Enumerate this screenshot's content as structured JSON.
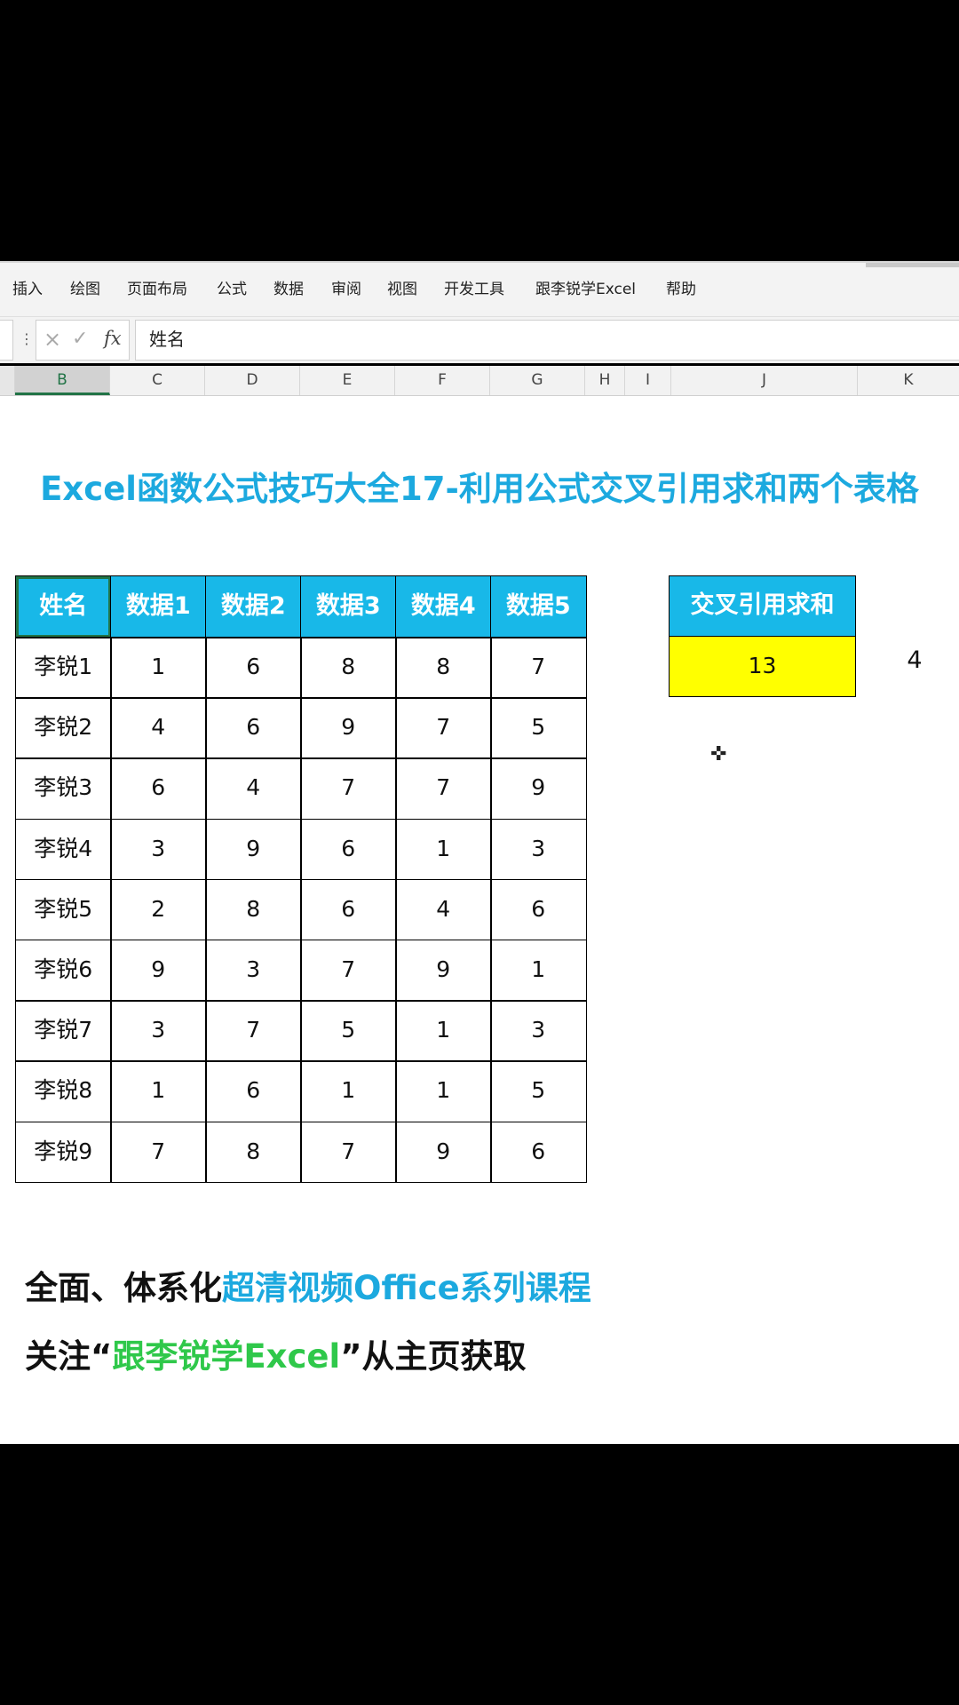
{
  "menu": [
    "插入",
    "绘图",
    "页面布局",
    "公式",
    "数据",
    "审阅",
    "视图",
    "开发工具",
    "跟李锐学Excel",
    "帮助"
  ],
  "formula_bar": {
    "fx_label": "fx",
    "cancel_icon": "×",
    "confirm_icon": "✓",
    "content": "姓名"
  },
  "columns": [
    "B",
    "C",
    "D",
    "E",
    "F",
    "G",
    "H",
    "I",
    "J",
    "K"
  ],
  "title": "Excel函数公式技巧大全17-利用公式交叉引用求和两个表格",
  "table": {
    "headers": [
      "姓名",
      "数据1",
      "数据2",
      "数据3",
      "数据4",
      "数据5"
    ],
    "rows": [
      [
        "李锐1",
        "1",
        "6",
        "8",
        "8",
        "7"
      ],
      [
        "李锐2",
        "4",
        "6",
        "9",
        "7",
        "5"
      ],
      [
        "李锐3",
        "6",
        "4",
        "7",
        "7",
        "9"
      ],
      [
        "李锐4",
        "3",
        "9",
        "6",
        "1",
        "3"
      ],
      [
        "李锐5",
        "2",
        "8",
        "6",
        "4",
        "6"
      ],
      [
        "李锐6",
        "9",
        "3",
        "7",
        "9",
        "1"
      ],
      [
        "李锐7",
        "3",
        "7",
        "5",
        "1",
        "3"
      ],
      [
        "李锐8",
        "1",
        "6",
        "1",
        "1",
        "5"
      ],
      [
        "李锐9",
        "7",
        "8",
        "7",
        "9",
        "6"
      ]
    ]
  },
  "cross_sum": {
    "header": "交叉引用求和",
    "value": "13",
    "side_value": "4",
    "highlight": "#ffff00"
  },
  "promo": {
    "line1_a": "全面、体系化",
    "line1_b": "超清视频Office系列课程",
    "line2_a": "关注“",
    "line2_b": "跟李锐学Excel",
    "line2_c": "”从主页获取"
  },
  "colors": {
    "header_bg": "#18b8e8",
    "title": "#1ca9df",
    "green": "#2fc84a"
  }
}
